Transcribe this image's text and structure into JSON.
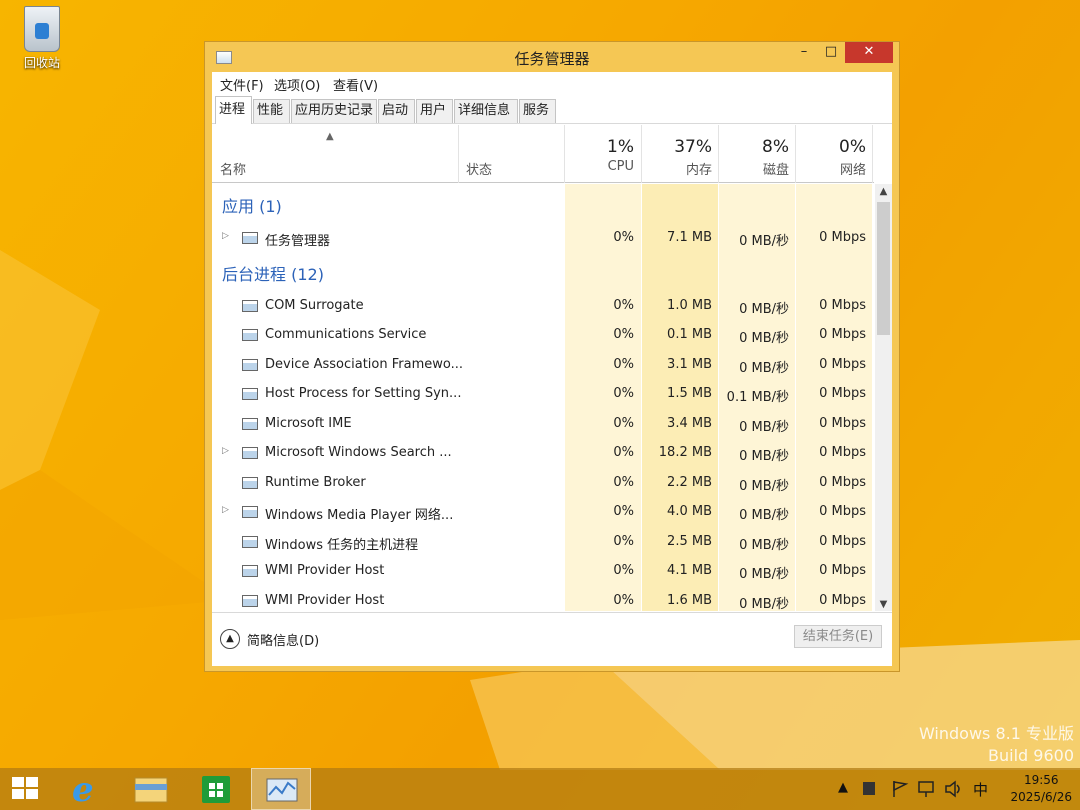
{
  "desktop": {
    "recycle_bin_label": "回收站"
  },
  "window": {
    "title": "任务管理器",
    "controls": {
      "minimize": "–",
      "maximize": "□",
      "close": "✕"
    }
  },
  "menu": [
    "文件(F)",
    "选项(O)",
    "查看(V)"
  ],
  "tabs": [
    "进程",
    "性能",
    "应用历史记录",
    "启动",
    "用户",
    "详细信息",
    "服务"
  ],
  "active_tab": "进程",
  "columns": {
    "name": "名称",
    "status": "状态",
    "cpu": {
      "pct": "1%",
      "label": "CPU"
    },
    "memory": {
      "pct": "37%",
      "label": "内存"
    },
    "disk": {
      "pct": "8%",
      "label": "磁盘"
    },
    "network": {
      "pct": "0%",
      "label": "网络"
    }
  },
  "groups": [
    {
      "title": "应用 (1)",
      "rows": [
        {
          "name": "任务管理器",
          "expandable": true,
          "cpu": "0%",
          "memory": "7.1 MB",
          "disk": "0 MB/秒",
          "network": "0 Mbps"
        }
      ]
    },
    {
      "title": "后台进程 (12)",
      "rows": [
        {
          "name": "COM Surrogate",
          "expandable": false,
          "cpu": "0%",
          "memory": "1.0 MB",
          "disk": "0 MB/秒",
          "network": "0 Mbps"
        },
        {
          "name": "Communications Service",
          "expandable": false,
          "cpu": "0%",
          "memory": "0.1 MB",
          "disk": "0 MB/秒",
          "network": "0 Mbps"
        },
        {
          "name": "Device Association Framewo...",
          "expandable": false,
          "cpu": "0%",
          "memory": "3.1 MB",
          "disk": "0 MB/秒",
          "network": "0 Mbps"
        },
        {
          "name": "Host Process for Setting Syn...",
          "expandable": false,
          "cpu": "0%",
          "memory": "1.5 MB",
          "disk": "0.1 MB/秒",
          "network": "0 Mbps"
        },
        {
          "name": "Microsoft IME",
          "expandable": false,
          "cpu": "0%",
          "memory": "3.4 MB",
          "disk": "0 MB/秒",
          "network": "0 Mbps"
        },
        {
          "name": "Microsoft Windows Search ...",
          "expandable": true,
          "cpu": "0%",
          "memory": "18.2 MB",
          "disk": "0 MB/秒",
          "network": "0 Mbps"
        },
        {
          "name": "Runtime Broker",
          "expandable": false,
          "cpu": "0%",
          "memory": "2.2 MB",
          "disk": "0 MB/秒",
          "network": "0 Mbps"
        },
        {
          "name": "Windows Media Player 网络...",
          "expandable": true,
          "cpu": "0%",
          "memory": "4.0 MB",
          "disk": "0 MB/秒",
          "network": "0 Mbps"
        },
        {
          "name": "Windows 任务的主机进程",
          "expandable": false,
          "cpu": "0%",
          "memory": "2.5 MB",
          "disk": "0 MB/秒",
          "network": "0 Mbps"
        },
        {
          "name": "WMI Provider Host",
          "expandable": false,
          "cpu": "0%",
          "memory": "4.1 MB",
          "disk": "0 MB/秒",
          "network": "0 Mbps"
        },
        {
          "name": "WMI Provider Host",
          "expandable": false,
          "cpu": "0%",
          "memory": "1.6 MB",
          "disk": "0 MB/秒",
          "network": "0 Mbps"
        }
      ]
    }
  ],
  "footer": {
    "fewer_details": "简略信息(D)",
    "end_task": "结束任务(E)"
  },
  "watermark": {
    "line1": "Windows 8.1 专业版",
    "line2": "Build 9600"
  },
  "taskbar": {
    "tray_ime": "中",
    "clock_time": "19:56",
    "clock_date": "2025/6/26"
  },
  "colors": {
    "desktop_bg": "#f6aa00",
    "window_frame": "#f5c754",
    "close_button": "#c7372c",
    "group_title": "#2c62b8",
    "heat_light": "#fef5d6",
    "heat_medium": "#fcedb5"
  }
}
